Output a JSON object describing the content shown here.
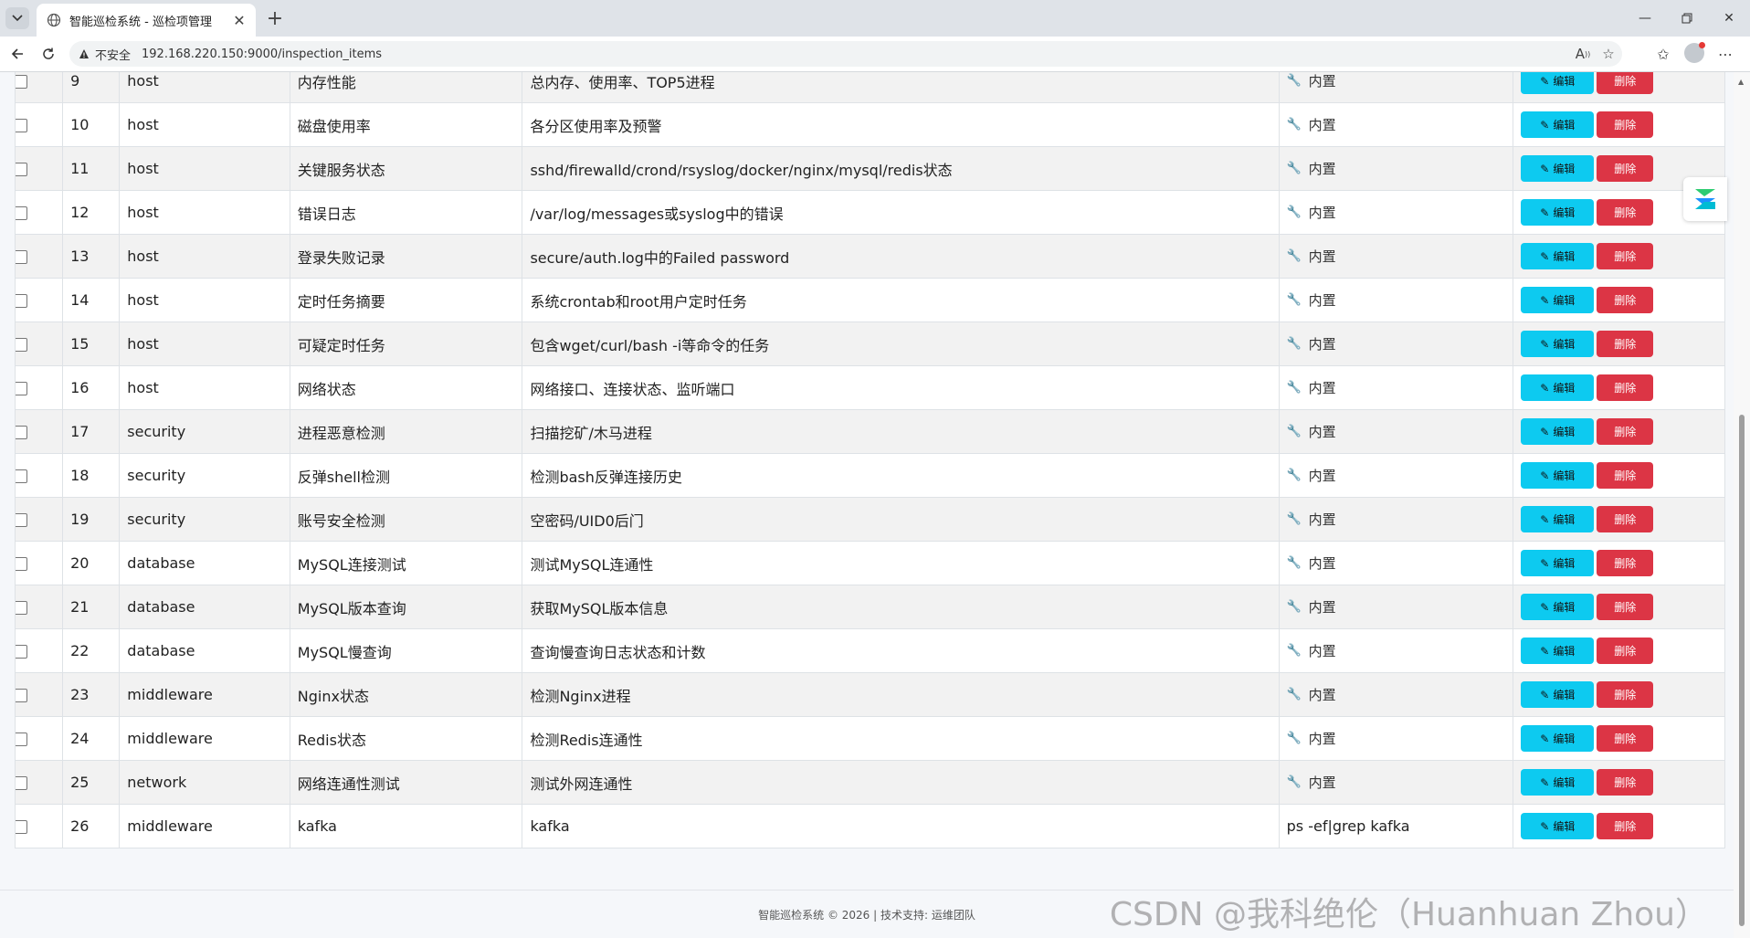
{
  "browser": {
    "tab_title": "智能巡检系统 - 巡检项管理",
    "insecure_label": "不安全",
    "url": "192.168.220.150:9000/inspection_items",
    "new_tab_symbol": "+"
  },
  "table": {
    "edit_label": "编辑",
    "delete_label": "删除",
    "rows": [
      {
        "id": "9",
        "category": "host",
        "name": "内存性能",
        "description": "总内存、使用率、TOP5进程",
        "command": "内置",
        "builtin": true
      },
      {
        "id": "10",
        "category": "host",
        "name": "磁盘使用率",
        "description": "各分区使用率及预警",
        "command": "内置",
        "builtin": true
      },
      {
        "id": "11",
        "category": "host",
        "name": "关键服务状态",
        "description": "sshd/firewalld/crond/rsyslog/docker/nginx/mysql/redis状态",
        "command": "内置",
        "builtin": true
      },
      {
        "id": "12",
        "category": "host",
        "name": "错误日志",
        "description": "/var/log/messages或syslog中的错误",
        "command": "内置",
        "builtin": true
      },
      {
        "id": "13",
        "category": "host",
        "name": "登录失败记录",
        "description": "secure/auth.log中的Failed password",
        "command": "内置",
        "builtin": true
      },
      {
        "id": "14",
        "category": "host",
        "name": "定时任务摘要",
        "description": "系统crontab和root用户定时任务",
        "command": "内置",
        "builtin": true
      },
      {
        "id": "15",
        "category": "host",
        "name": "可疑定时任务",
        "description": "包含wget/curl/bash -i等命令的任务",
        "command": "内置",
        "builtin": true
      },
      {
        "id": "16",
        "category": "host",
        "name": "网络状态",
        "description": "网络接口、连接状态、监听端口",
        "command": "内置",
        "builtin": true
      },
      {
        "id": "17",
        "category": "security",
        "name": "进程恶意检测",
        "description": "扫描挖矿/木马进程",
        "command": "内置",
        "builtin": true
      },
      {
        "id": "18",
        "category": "security",
        "name": "反弹shell检测",
        "description": "检测bash反弹连接历史",
        "command": "内置",
        "builtin": true
      },
      {
        "id": "19",
        "category": "security",
        "name": "账号安全检测",
        "description": "空密码/UID0后门",
        "command": "内置",
        "builtin": true
      },
      {
        "id": "20",
        "category": "database",
        "name": "MySQL连接测试",
        "description": "测试MySQL连通性",
        "command": "内置",
        "builtin": true
      },
      {
        "id": "21",
        "category": "database",
        "name": "MySQL版本查询",
        "description": "获取MySQL版本信息",
        "command": "内置",
        "builtin": true
      },
      {
        "id": "22",
        "category": "database",
        "name": "MySQL慢查询",
        "description": "查询慢查询日志状态和计数",
        "command": "内置",
        "builtin": true
      },
      {
        "id": "23",
        "category": "middleware",
        "name": "Nginx状态",
        "description": "检测Nginx进程",
        "command": "内置",
        "builtin": true
      },
      {
        "id": "24",
        "category": "middleware",
        "name": "Redis状态",
        "description": "检测Redis连通性",
        "command": "内置",
        "builtin": true
      },
      {
        "id": "25",
        "category": "network",
        "name": "网络连通性测试",
        "description": "测试外网连通性",
        "command": "内置",
        "builtin": true
      },
      {
        "id": "26",
        "category": "middleware",
        "name": "kafka",
        "description": "kafka",
        "command": "ps -ef|grep kafka",
        "builtin": false
      }
    ]
  },
  "footer": {
    "text": "智能巡检系统 © 2026 | 技术支持: 运维团队"
  },
  "watermark": "CSDN @我科绝伦（Huanhuan Zhou）",
  "colors": {
    "edit_button": "#0dcaf0",
    "delete_button": "#dc3545"
  }
}
